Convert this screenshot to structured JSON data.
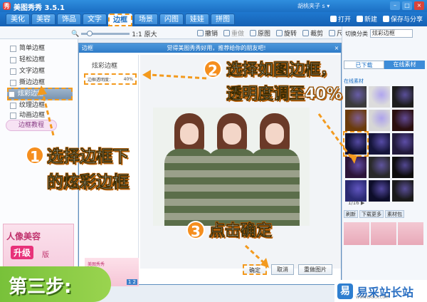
{
  "window": {
    "app_title": "美图秀秀 3.5.1",
    "logo_glyph": "秀",
    "user": "胡桃夹子 s ▾",
    "buttons": [
      "–",
      "□",
      "×"
    ]
  },
  "main_tabs": [
    {
      "label": "美化"
    },
    {
      "label": "美容"
    },
    {
      "label": "饰品"
    },
    {
      "label": "文字"
    },
    {
      "label": "边框"
    },
    {
      "label": "场景"
    },
    {
      "label": "闪图"
    },
    {
      "label": "娃娃"
    },
    {
      "label": "拼图"
    }
  ],
  "top_actions": {
    "open": "打开",
    "new": "新建",
    "save": "保存与分享"
  },
  "toolbar": {
    "zoom_label": "1:1 原大",
    "tools": [
      "撤销",
      "重做",
      "原图",
      "旋转",
      "裁剪",
      "尺寸"
    ]
  },
  "sidebar": {
    "items": [
      {
        "label": "简单边框"
      },
      {
        "label": "轻松边框"
      },
      {
        "label": "文字边框"
      },
      {
        "label": "撕边边框"
      },
      {
        "label": "炫彩边框"
      },
      {
        "label": "纹理边框"
      },
      {
        "label": "动画边框"
      }
    ],
    "tutorial": "边框教程",
    "promo": {
      "line1": "人像美容",
      "badge": "升级",
      "line2": "版"
    }
  },
  "dialog": {
    "title": "边框",
    "message": "觉得美图秀秀好用，推荐给你的朋友吧!",
    "close": "×",
    "heading": "炫彩边框",
    "opacity_label": "边框透明度：",
    "opacity_value": "40%",
    "thumb_label": "美图秀秀",
    "thumb_page": "1 2",
    "ok": "确定",
    "cancel": "取消",
    "reset": "重做图片"
  },
  "right_panel": {
    "class_label": "切换分类",
    "class_value": "炫彩边框",
    "tab_local": "已下载",
    "tab_online": "在线素材",
    "online_link": "在线素材",
    "page": "1/16 ▶",
    "actions": [
      "刷新",
      "下载更多",
      "素材包"
    ],
    "colors": {
      "cells": [
        "#3b3b3b",
        "#dcdcdc",
        "#1c1c1c",
        "#6b3b0b",
        "#d6d6d6",
        "#2b0f0f",
        "#0f1030",
        "#15153a",
        "#221a3b",
        "#2c1538",
        "#2a2a2a",
        "#0d0d0d",
        "#2a2a72",
        "#0d0d2a",
        "#1a1a1a"
      ]
    }
  },
  "annotations": {
    "step1_num": "1",
    "step1_line1": "选择边框下",
    "step1_line2": "的炫彩边框",
    "step2_num": "2",
    "step2_line1": "选择如图边框，",
    "step2_line2": "透明度调至40%",
    "step3_num": "3",
    "step3_text": "点击确定",
    "step_badge": "第三步:"
  },
  "watermark": {
    "logo": "易",
    "text": "易采站长站",
    "url": "WWW.EASCK.COM"
  },
  "accent_color": "#f39a1e"
}
